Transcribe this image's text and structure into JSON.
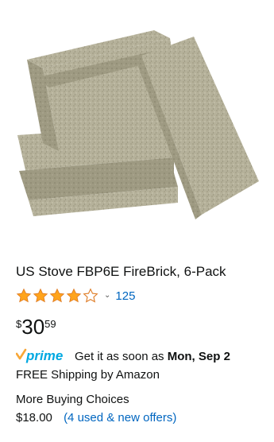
{
  "product": {
    "title": "US Stove FBP6E FireBrick, 6-Pack",
    "rating": {
      "stars": 4.0,
      "max": 5,
      "count": "125"
    },
    "price": {
      "symbol": "$",
      "whole": "30",
      "fraction": "59"
    },
    "prime": {
      "logo_text": "prime",
      "delivery_prefix": "Get it as soon as",
      "delivery_date": "Mon, Sep 2"
    },
    "shipping": "FREE Shipping by Amazon",
    "more_buying": {
      "label": "More Buying Choices",
      "price": "$18.00",
      "offers_link": "(4 used & new offers)"
    }
  },
  "colors": {
    "star": "#ffa41c",
    "prime_blue": "#00a8e1",
    "prime_check": "#f7a738",
    "link": "#0066c0",
    "text": "#0f1111"
  },
  "icons": {
    "star": "star-icon",
    "chevron": "chevron-down-icon",
    "prime": "prime-logo-icon"
  }
}
